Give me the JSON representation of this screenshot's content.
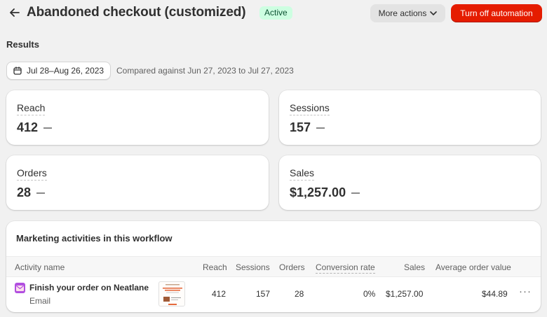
{
  "header": {
    "title": "Abandoned checkout (customized)",
    "status": "Active",
    "more_actions_label": "More actions",
    "turn_off_label": "Turn off automation"
  },
  "results": {
    "label": "Results",
    "date_range": "Jul 28–Aug 26, 2023",
    "comparison": "Compared against Jun 27, 2023 to Jul 27, 2023"
  },
  "metrics": {
    "reach": {
      "label": "Reach",
      "value": "412"
    },
    "sessions": {
      "label": "Sessions",
      "value": "157"
    },
    "orders": {
      "label": "Orders",
      "value": "28"
    },
    "sales": {
      "label": "Sales",
      "value": "$1,257.00"
    }
  },
  "activities": {
    "title": "Marketing activities in this workflow",
    "columns": {
      "activity_name": "Activity name",
      "reach": "Reach",
      "sessions": "Sessions",
      "orders": "Orders",
      "conversion_rate": "Conversion rate",
      "sales": "Sales",
      "avg_order_value": "Average order value"
    },
    "rows": [
      {
        "name": "Finish your order on Neatlane",
        "type": "Email",
        "reach": "412",
        "sessions": "157",
        "orders": "28",
        "conversion_rate": "0%",
        "sales": "$1,257.00",
        "avg_order_value": "$44.89",
        "menu": "···"
      }
    ]
  },
  "colors": {
    "accent_red": "#e51c00",
    "badge_bg": "#cdfee1",
    "badge_text": "#0c5132",
    "email_icon": "#b14fe0"
  },
  "icons": {
    "back": "arrow-left-icon",
    "dropdown": "chevron-down-icon",
    "calendar": "calendar-icon",
    "email": "email-icon",
    "row_menu": "more-horizontal-icon"
  }
}
